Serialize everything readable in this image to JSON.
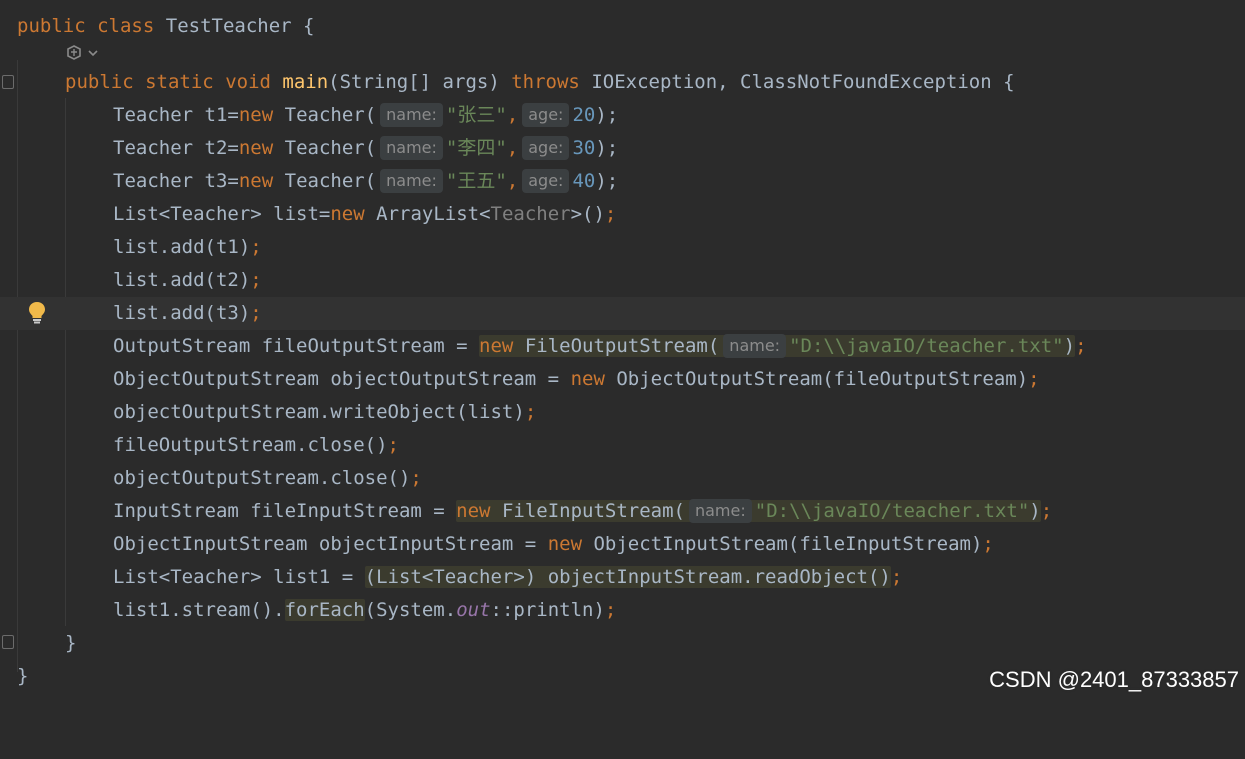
{
  "editor": {
    "class_line": {
      "kw1": "public",
      "kw2": "class",
      "name": "TestTeacher",
      "brace": "{"
    },
    "main_sig": {
      "kw1": "public",
      "kw2": "static",
      "kw3": "void",
      "method": "main",
      "params": "(String[] args)",
      "throws": "throws",
      "exceptions": "IOException, ClassNotFoundException",
      "brace": "{"
    },
    "teachers": [
      {
        "prefix": "Teacher t1=",
        "kw": "new",
        "ctor": "Teacher(",
        "hint_name": "name:",
        "name": "\"张三\"",
        "comma": ",",
        "hint_age": "age:",
        "age": "20",
        "close": ");"
      },
      {
        "prefix": "Teacher t2=",
        "kw": "new",
        "ctor": "Teacher(",
        "hint_name": "name:",
        "name": "\"李四\"",
        "comma": ",",
        "hint_age": "age:",
        "age": "30",
        "close": ");"
      },
      {
        "prefix": "Teacher t3=",
        "kw": "new",
        "ctor": "Teacher(",
        "hint_name": "name:",
        "name": "\"王五\"",
        "comma": ",",
        "hint_age": "age:",
        "age": "40",
        "close": ");"
      }
    ],
    "list_decl": {
      "prefix": "List<Teacher> list=",
      "kw": "new",
      "type": "ArrayList<",
      "generic": "Teacher",
      "close": ">()",
      "semi": ";"
    },
    "adds": [
      "list.add(t1)",
      "list.add(t2)",
      "list.add(t3)"
    ],
    "semicolon": ";",
    "fos_decl": {
      "prefix": "OutputStream fileOutputStream = ",
      "kw": "new",
      "ctor": "FileOutputStream(",
      "hint": "name:",
      "path": "\"D:\\\\javaIO/teacher.txt\"",
      "close": ")",
      "semi": ";"
    },
    "oos_decl": {
      "prefix": "ObjectOutputStream objectOutputStream = ",
      "kw": "new",
      "rest": "ObjectOutputStream(fileOutputStream)",
      "semi": ";"
    },
    "write_obj": "objectOutputStream.writeObject(list)",
    "fos_close": "fileOutputStream.close()",
    "oos_close": "objectOutputStream.close()",
    "fis_decl": {
      "prefix": "InputStream fileInputStream = ",
      "kw": "new",
      "ctor": "FileInputStream(",
      "hint": "name:",
      "path": "\"D:\\\\javaIO/teacher.txt\"",
      "close": ")",
      "semi": ";"
    },
    "ois_decl": {
      "prefix": "ObjectInputStream objectInputStream = ",
      "kw": "new",
      "rest": "ObjectInputStream(fileInputStream)",
      "semi": ";"
    },
    "list1_decl": {
      "prefix": "List<Teacher> list1 = ",
      "cast": "(List<Teacher>) objectInputStream.readObject()",
      "semi": ";"
    },
    "stream_line": {
      "prefix": "list1.stream().",
      "method": "forEach",
      "args1": "(System.",
      "field": "out",
      "args2": "::println)",
      "semi": ";"
    },
    "close_method": "}",
    "close_class": "}"
  },
  "watermark": "CSDN @2401_87333857",
  "colors": {
    "background": "#2b2b2b",
    "keyword": "#cc7832",
    "string": "#6a8759",
    "number": "#6897bb",
    "method_decl": "#ffc66d",
    "default_text": "#a9b7c6"
  },
  "icons": [
    "fold-marker-icon",
    "ai-assistant-icon",
    "lightbulb-icon"
  ]
}
